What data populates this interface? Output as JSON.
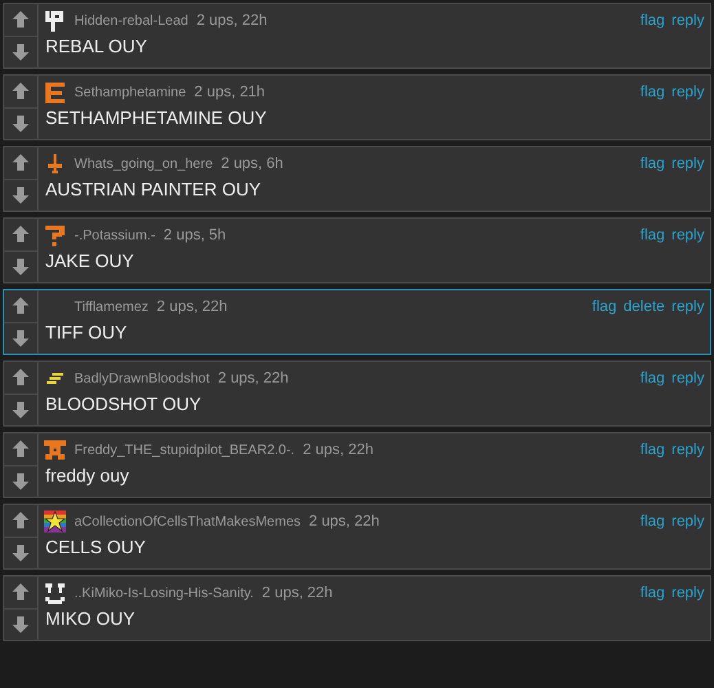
{
  "comments": [
    {
      "avatar": {
        "kind": "tu"
      },
      "username": "Hidden-rebal-Lead",
      "meta": "2 ups, 22h",
      "text": "REBAL OUY",
      "highlighted": false,
      "actions": [
        "flag",
        "reply"
      ]
    },
    {
      "avatar": {
        "kind": "e"
      },
      "username": "Sethamphetamine",
      "meta": "2 ups, 21h",
      "text": "SETHAMPHETAMINE OUY",
      "highlighted": false,
      "actions": [
        "flag",
        "reply"
      ]
    },
    {
      "avatar": {
        "kind": "dagger"
      },
      "username": "Whats_going_on_here",
      "meta": "2 ups, 6h",
      "text": "AUSTRIAN PAINTER OUY",
      "highlighted": false,
      "actions": [
        "flag",
        "reply"
      ]
    },
    {
      "avatar": {
        "kind": "question"
      },
      "username": "-.Potassium.-",
      "meta": "2 ups, 5h",
      "text": "JAKE OUY",
      "highlighted": false,
      "actions": [
        "flag",
        "reply"
      ]
    },
    {
      "username": "Tifflamemez",
      "meta": "2 ups, 22h",
      "text": "TIFF OUY",
      "highlighted": true,
      "actions": [
        "flag",
        "delete",
        "reply"
      ]
    },
    {
      "avatar": {
        "kind": "bolt"
      },
      "username": "BadlyDrawnBloodshot",
      "meta": "2 ups, 22h",
      "text": "BLOODSHOT OUY",
      "highlighted": false,
      "actions": [
        "flag",
        "reply"
      ]
    },
    {
      "avatar": {
        "kind": "bear"
      },
      "username": "Freddy_THE_stupidpilot_BEAR2.0-.",
      "meta": "2 ups, 22h",
      "text": "freddy ouy",
      "highlighted": false,
      "actions": [
        "flag",
        "reply"
      ]
    },
    {
      "avatar": {
        "kind": "star"
      },
      "username": "aCollectionOfCellsThatMakesMemes",
      "meta": "2 ups, 22h",
      "text": "CELLS OUY",
      "highlighted": false,
      "actions": [
        "flag",
        "reply"
      ]
    },
    {
      "avatar": {
        "kind": "face"
      },
      "username": "..KiMiko-Is-Losing-His-Sanity.",
      "meta": "2 ups, 22h",
      "text": "MIKO OUY",
      "highlighted": false,
      "actions": [
        "flag",
        "reply"
      ]
    }
  ]
}
